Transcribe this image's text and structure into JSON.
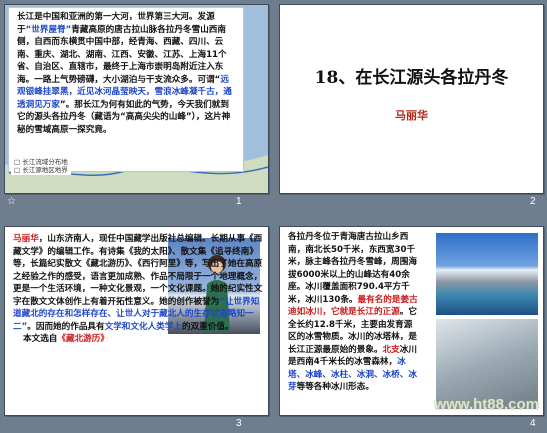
{
  "slide1": {
    "number": "1",
    "text_a": "长江是中国和亚洲的第一大河，世界第三大河。发源于",
    "text_b": "“世界屋脊”",
    "text_c": "青藏高原的唐古拉山脉各拉丹冬雪山西南侧，自西而东横贯中国中部，经青海、西藏、四川、云南、重庆、湖北、湖南、江西、安徽、江苏、上海11个省、自治区、直辖市，最终于上海市崇明岛附近注入东海。一路上气势磅礴，大小湖泊与干支流众多。可谓“",
    "text_d": "远观银峰挂翠黑，近见冰河晶莹映天，雪浪冰峰凝千古，通透洞见万家",
    "text_e": "”。那长江为何有如此的气势，今天我们就到它的源头各拉丹冬（藏语为“高高尖尖的山峰”），这片神秘的雪域高原一探究竟。",
    "legend_1": "□ 长江流域分布地",
    "legend_2": "□ 长江源地区地界"
  },
  "slide2": {
    "number": "2",
    "title": "18、在长江源头各拉丹冬",
    "author": "马丽华"
  },
  "slide3": {
    "number": "3",
    "name": "马丽华",
    "text_a": "，山东济南人，现任中国藏学出版社总编辑。长期从事《西藏文学》的编辑工作。有诗集《我的太阳》、散文集《追寻终南》等，长篇纪实散文《藏北游历》、《西行阿里》等，写出了她在高原之经验之作的感受，语言更加成熟、作品不局限于一个地理概念，更是一个生活环境，一种文化景观，一个文化课题。她的纪实性文字在散文文体创作上有着开拓性意义。她的创作被誉为",
    "text_b": "“让世界知道藏北的存在和怎样存在、让世人对于藏北人的生存状态略知一二”",
    "text_c": "。因而她的作品具有",
    "text_d": "文学和文化人类学上",
    "text_e": "的双重价值。",
    "source_a": "本文选自",
    "source_b": "《藏北游历》"
  },
  "slide4": {
    "number": "4",
    "text_a": "各拉丹冬位于青海唐古拉山乡西南，南北长50千米，东西宽30千米，脉主峰各拉丹冬雪峰，周围海拔6000米以上的山峰达有40余座。冰川覆盖面积790.4平方千米，冰川130条。",
    "text_b": "最有名的是姜古迪如冰川，它就是长江的正源",
    "text_c": "。它全长约12.8千米，主要由发育源区的冰雪物质。冰川的冰塔林，是长江正源最原始的景象。",
    "text_d": "北支",
    "text_e": "冰川是西南4千米长的冰雪森林，",
    "text_f": "冰塔、冰峰、冰柱、冰洞、冰桥、冰芽",
    "text_g": "等等各种冰川形态。",
    "watermark": "www.ht88.com"
  },
  "ui": {
    "star_symbol": "☆"
  }
}
